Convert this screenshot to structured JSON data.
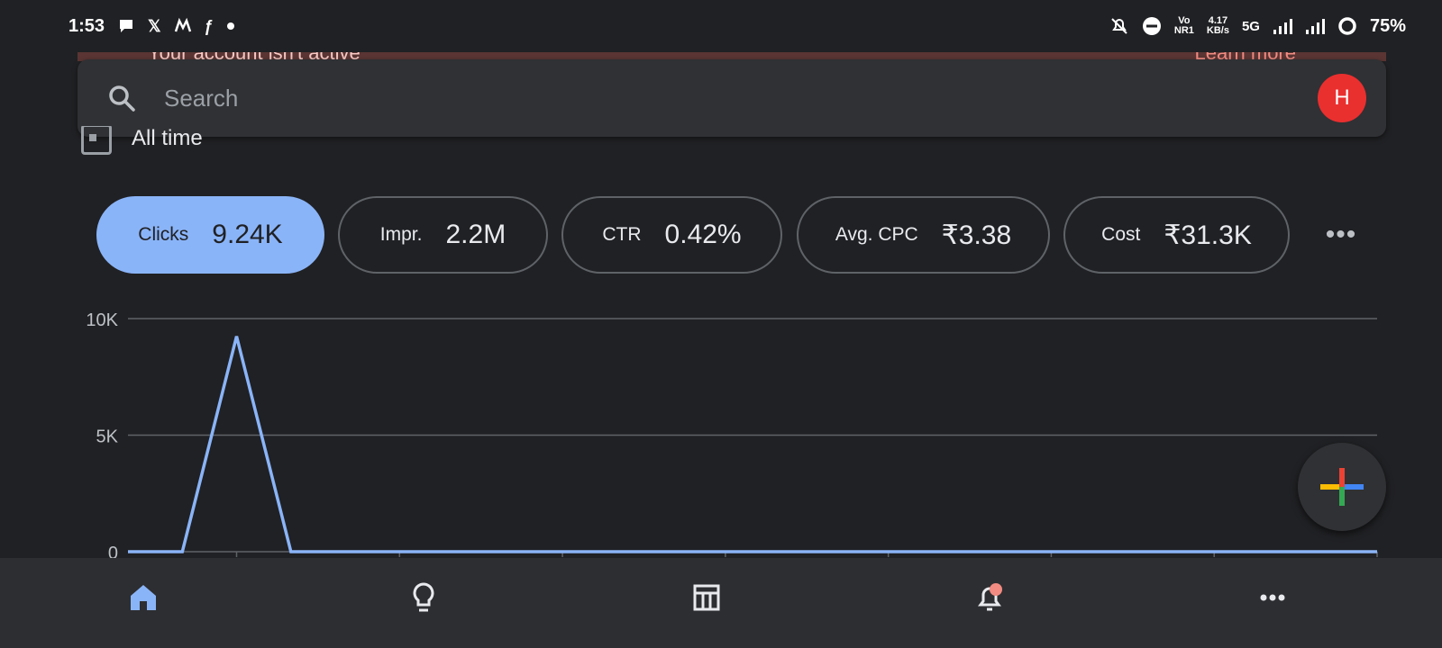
{
  "status_bar": {
    "time": "1:53",
    "network_top": "Vo",
    "network_bottom": "NR1",
    "speed_value": "4.17",
    "speed_unit": "KB/s",
    "network_type": "5G",
    "battery": "75%"
  },
  "banner": {
    "text": "Your account isn't active",
    "link": "Learn more"
  },
  "search": {
    "placeholder": "Search",
    "avatar_letter": "H",
    "avatar_color": "#ea2f2f"
  },
  "date_filter": {
    "label": "All time"
  },
  "metrics": [
    {
      "label": "Clicks",
      "value": "9.24K",
      "active": true
    },
    {
      "label": "Impr.",
      "value": "2.2M",
      "active": false
    },
    {
      "label": "CTR",
      "value": "0.42%",
      "active": false
    },
    {
      "label": "Avg. CPC",
      "value": "₹3.38",
      "active": false
    },
    {
      "label": "Cost",
      "value": "₹31.3K",
      "active": false
    }
  ],
  "chart_data": {
    "type": "line",
    "title": "",
    "xlabel": "",
    "ylabel": "",
    "y_ticks": [
      "10K",
      "5K",
      "0"
    ],
    "ylim": [
      0,
      10000
    ],
    "series": [
      {
        "color": "#8ab4f8",
        "values": [
          0,
          0,
          9240,
          0,
          0,
          0,
          0,
          0,
          0,
          0,
          0,
          0,
          0,
          0,
          0,
          0,
          0,
          0,
          0,
          0,
          0,
          0,
          0,
          0
        ]
      }
    ],
    "grid": true
  },
  "colors": {
    "accent": "#8ab4f8",
    "background": "#202124",
    "surface": "#303134"
  },
  "bottom_nav": {
    "items": [
      "home-icon",
      "lightbulb-icon",
      "table-icon",
      "notifications-icon",
      "more-icon"
    ],
    "active": "home-icon"
  }
}
